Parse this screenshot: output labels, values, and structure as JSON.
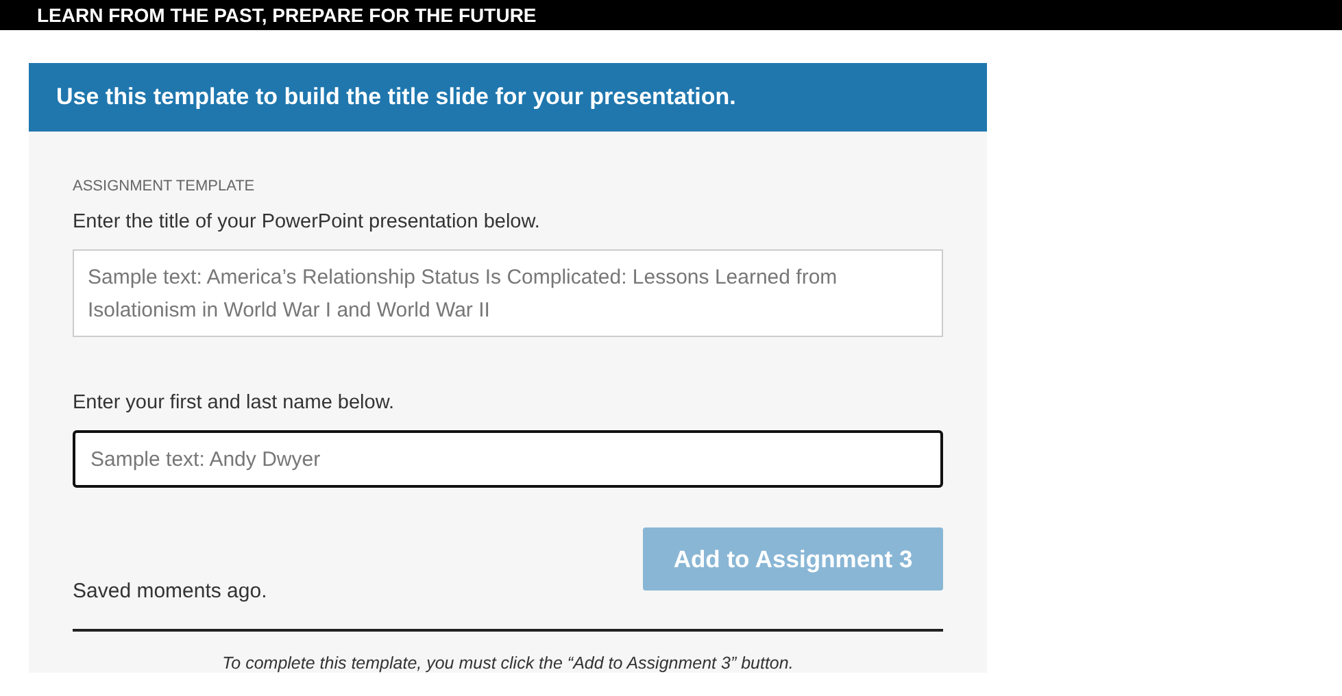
{
  "top_bar": {
    "title": "LEARN FROM THE PAST, PREPARE FOR THE FUTURE"
  },
  "panel": {
    "heading": "Use this template to build the title slide for your presentation.",
    "eyebrow": "ASSIGNMENT TEMPLATE",
    "fields": [
      {
        "label": "Enter the title of your PowerPoint presentation below.",
        "placeholder": "Sample text: America’s Relationship Status Is Complicated: Lessons Learned from Isolationism in World War I and World War II",
        "kind": "textarea",
        "focused": false
      },
      {
        "label": "Enter your first and last name below.",
        "placeholder": "Sample text: Andy Dwyer",
        "kind": "input",
        "focused": true
      }
    ],
    "status": "Saved moments ago.",
    "button": {
      "label": "Add to Assignment 3",
      "disabled": true
    },
    "footnote": "To complete this template, you must click the “Add to Assignment 3” button."
  }
}
